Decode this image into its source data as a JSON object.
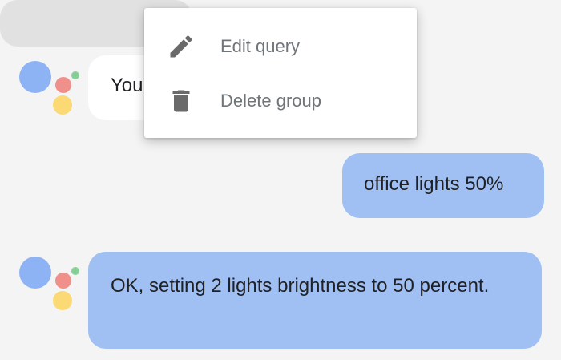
{
  "conversation": {
    "messages": [
      {
        "role": "user",
        "text": ""
      },
      {
        "role": "assistant",
        "text": "You"
      },
      {
        "role": "user",
        "text": "office lights 50%"
      },
      {
        "role": "assistant",
        "text": "OK, setting 2 lights brightness to 50 percent."
      }
    ]
  },
  "context_menu": {
    "items": [
      {
        "label": "Edit query",
        "icon": "pencil-icon"
      },
      {
        "label": "Delete group",
        "icon": "trash-icon"
      }
    ]
  },
  "colors": {
    "background": "#f4f4f4",
    "user_bubble": "#a0c0f3",
    "assistant_bubble_white": "#ffffff",
    "menu_text": "#70757a",
    "logo_blue": "#8eb3f5",
    "logo_red": "#ef918a",
    "logo_yellow": "#fbd975",
    "logo_green": "#86cf95"
  }
}
